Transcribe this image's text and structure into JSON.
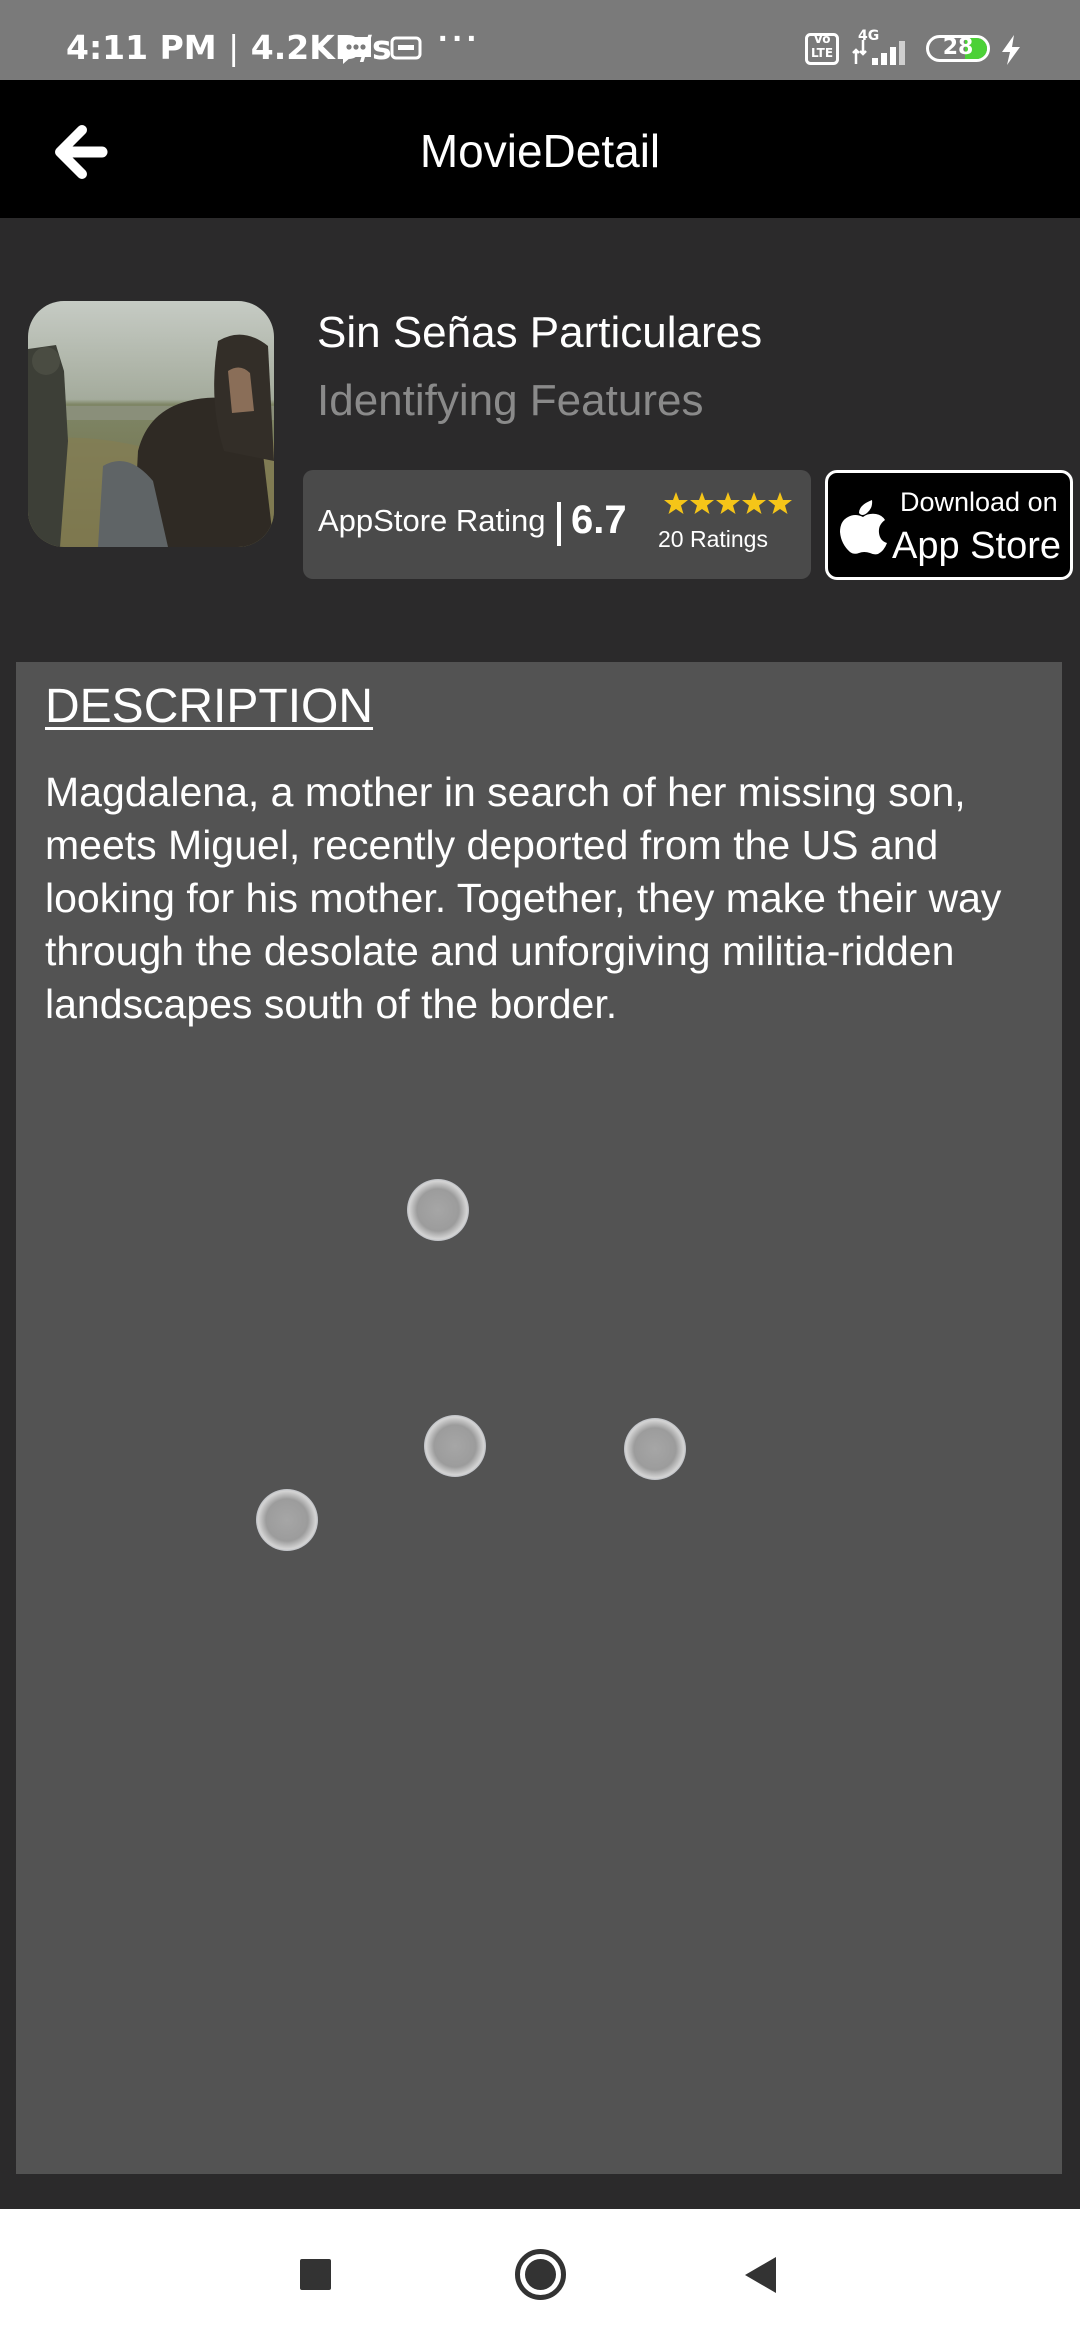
{
  "status_bar": {
    "time": "4:11 PM",
    "separator": "|",
    "speed": "4.2KB/s",
    "more_dots": "···",
    "volte_top": "Vo",
    "volte_bottom": "LTE",
    "network": "4G",
    "battery_level": "28",
    "battery_color": "#4cd137"
  },
  "app_bar": {
    "title": "MovieDetail",
    "back_icon": "arrow-left-icon"
  },
  "movie": {
    "title": "Sin Señas Particulares",
    "subtitle": "Identifying Features"
  },
  "rating": {
    "label": "AppStore Rating",
    "value": "6.7",
    "stars": 5,
    "star_color": "#f5c518",
    "count_text": "20 Ratings"
  },
  "appstore_badge": {
    "line1": "Download on",
    "line2": "App Store",
    "icon": "apple-icon"
  },
  "description": {
    "heading": "DESCRIPTION",
    "text": "Magdalena, a mother in search of her missing son, meets Miguel, recently deported from the US and looking for his mother. Together, they make their way through the desolate and unforgiving militia-ridden landscapes south of the border."
  },
  "nav_bar": {
    "recent_icon": "square-icon",
    "home_icon": "circle-icon",
    "back_icon": "triangle-back-icon"
  }
}
